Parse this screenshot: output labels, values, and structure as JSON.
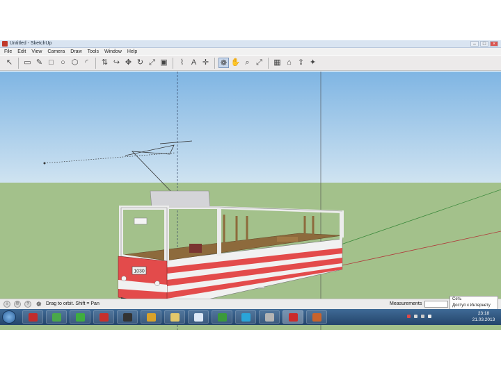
{
  "window": {
    "title": "Untitled - SketchUp",
    "buttons": [
      "–",
      "□",
      "×"
    ]
  },
  "menu": [
    "File",
    "Edit",
    "View",
    "Camera",
    "Draw",
    "Tools",
    "Window",
    "Help"
  ],
  "toolbar": {
    "tools": [
      {
        "icon": "select-arrow-icon",
        "glyph": "↖"
      },
      {
        "icon": "eraser-icon",
        "glyph": "▭"
      },
      {
        "icon": "pencil-icon",
        "glyph": "✎"
      },
      {
        "icon": "rectangle-icon",
        "glyph": "□"
      },
      {
        "icon": "circle-icon",
        "glyph": "○"
      },
      {
        "icon": "polygon-icon",
        "glyph": "⬡"
      },
      {
        "icon": "arc-icon",
        "glyph": "◜"
      },
      {
        "icon": "push-pull-icon",
        "glyph": "⇅"
      },
      {
        "icon": "follow-me-icon",
        "glyph": "↪"
      },
      {
        "icon": "move-icon",
        "glyph": "✥"
      },
      {
        "icon": "rotate-icon",
        "glyph": "↻"
      },
      {
        "icon": "scale-icon",
        "glyph": "⤢"
      },
      {
        "icon": "offset-icon",
        "glyph": "▣"
      },
      {
        "icon": "tape-measure-icon",
        "glyph": "⌇"
      },
      {
        "icon": "text-icon",
        "glyph": "A"
      },
      {
        "icon": "axes-icon",
        "glyph": "✛"
      },
      {
        "icon": "orbit-icon",
        "glyph": "❁"
      },
      {
        "icon": "pan-icon",
        "glyph": "✋"
      },
      {
        "icon": "zoom-icon",
        "glyph": "⌕"
      },
      {
        "icon": "zoom-extents-icon",
        "glyph": "⤢"
      },
      {
        "icon": "components-icon",
        "glyph": "▦"
      },
      {
        "icon": "warehouse-icon",
        "glyph": "⌂"
      },
      {
        "icon": "share-model-icon",
        "glyph": "⇪"
      },
      {
        "icon": "extension-icon",
        "glyph": "✦"
      }
    ],
    "active": "orbit-icon"
  },
  "scene": {
    "tram_number": "1030",
    "colors": {
      "sky": "#7fb5e3",
      "ground": "#a3c18b",
      "tram_red": "#e34b4b",
      "tram_white": "#f1f1f1",
      "wood": "#8d6a3c",
      "chassis": "#3a3a3a"
    }
  },
  "status": {
    "icons": [
      "info-icon",
      "credits-icon",
      "help-icon"
    ],
    "hint": "Drag to orbit.  Shift = Pan",
    "measurements_label": "Measurements"
  },
  "tray_popup": {
    "line1": "Сеть",
    "line2": "Доступ к Интернету"
  },
  "taskbar": {
    "apps": [
      {
        "name": "antivirus",
        "color": "#c22c2c"
      },
      {
        "name": "messenger",
        "color": "#4aa84a"
      },
      {
        "name": "media",
        "color": "#3fae3f"
      },
      {
        "name": "pdf-reader",
        "color": "#c8302c"
      },
      {
        "name": "recorder",
        "color": "#333333"
      },
      {
        "name": "chrome",
        "color": "#d9a22a"
      },
      {
        "name": "file-explorer",
        "color": "#e3c86a"
      },
      {
        "name": "notepad",
        "color": "#dce8f6"
      },
      {
        "name": "utorrent",
        "color": "#3b9a3b"
      },
      {
        "name": "skype",
        "color": "#2aa5d9"
      },
      {
        "name": "disk-tool",
        "color": "#b4b4b4"
      },
      {
        "name": "sketchup",
        "color": "#cc2b2b"
      },
      {
        "name": "archive-tool",
        "color": "#c8632b"
      }
    ],
    "clock_time": "23:18",
    "clock_date": "21.03.2013"
  }
}
